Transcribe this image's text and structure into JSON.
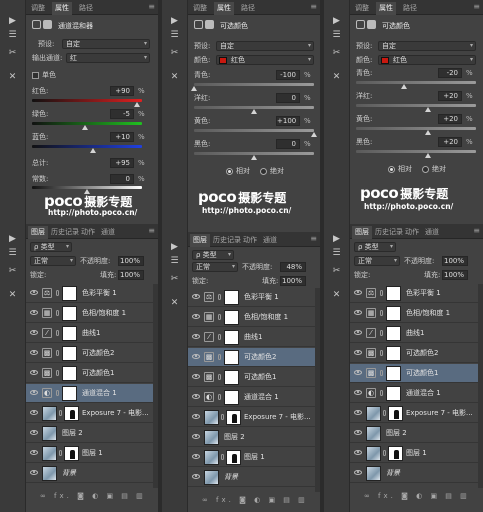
{
  "colors": {
    "panel_bg": "#424242",
    "dark": "#2f2f2f",
    "selected_row": "#596b80",
    "accent_red": "#c8180f"
  },
  "col1": {
    "tabs": [
      "调整",
      "属性",
      "路径"
    ],
    "header_title": "通道混和器",
    "preset_label": "预设:",
    "preset_value": "自定",
    "channel_label": "输出通道:",
    "channel_value": "红",
    "mono_label": "单色",
    "sliders": [
      {
        "label": "红色:",
        "value": "+90",
        "pct": "%",
        "level": 0.95
      },
      {
        "label": "绿色:",
        "value": "-5",
        "pct": "%",
        "level": 0.48
      },
      {
        "label": "蓝色:",
        "value": "+10",
        "pct": "%",
        "level": 0.55
      }
    ],
    "total_label": "总计:",
    "total_value": "+95",
    "total_pct": "%",
    "const_label": "常数:",
    "const_value": "0",
    "const_pct": "%",
    "logo": "poco",
    "logo_cn": "摄影专题",
    "url": "http://photo.poco.cn/",
    "layer_tabs": [
      "图层",
      "历史记录",
      "动作",
      "通道"
    ],
    "kind_label": "ρ 类型",
    "blend_mode": "正常",
    "opacity_label": "不透明度:",
    "opacity_value": "100%",
    "lock_label": "锁定:",
    "fill_label": "填充:",
    "fill_value": "100%",
    "footer_icons": "∞ fx. ◙ ◐ ▣ ▤ ▥",
    "layers": [
      {
        "name": "色彩平衡 1",
        "icon": "⚖",
        "type": "adj"
      },
      {
        "name": "色相/饱和度 1",
        "icon": "▦",
        "type": "adj"
      },
      {
        "name": "曲线1",
        "icon": "⁄",
        "type": "adj"
      },
      {
        "name": "可选颜色2",
        "icon": "▩",
        "type": "adj"
      },
      {
        "name": "可选颜色1",
        "icon": "▩",
        "type": "adj"
      },
      {
        "name": "通道混合 1",
        "icon": "◐",
        "type": "adj",
        "selected": true
      },
      {
        "name": "Exposure 7 - 电影...",
        "type": "img2"
      },
      {
        "name": "图层 2",
        "type": "img"
      },
      {
        "name": "图层 1",
        "type": "img2b"
      },
      {
        "name": "背景",
        "type": "img",
        "italic": true
      }
    ]
  },
  "col2": {
    "tabs": [
      "调整",
      "属性",
      "路径"
    ],
    "header_title": "可选颜色",
    "preset_label": "预设:",
    "preset_value": "自定",
    "color_label": "颜色:",
    "color_value": "红色",
    "sliders": [
      {
        "label": "青色:",
        "value": "-100",
        "pct": "%",
        "level": 0.0
      },
      {
        "label": "洋红:",
        "value": "0",
        "pct": "%",
        "level": 0.5
      },
      {
        "label": "黄色:",
        "value": "+100",
        "pct": "%",
        "level": 1.0
      },
      {
        "label": "黑色:",
        "value": "0",
        "pct": "%",
        "level": 0.5
      }
    ],
    "radio_relative": "相对",
    "radio_absolute": "绝对",
    "logo": "poco",
    "logo_cn": "摄影专题",
    "url": "http://photo.poco.cn/",
    "layer_tabs": [
      "图层",
      "历史记录",
      "动作",
      "通道"
    ],
    "kind_label": "ρ 类型",
    "blend_mode": "正常",
    "opacity_label": "不透明度:",
    "opacity_value": "48%",
    "lock_label": "锁定:",
    "fill_label": "填充:",
    "fill_value": "100%",
    "footer_icons": "∞ fx. ◙ ◐ ▣ ▤ ▥",
    "layers": [
      {
        "name": "色彩平衡 1",
        "icon": "⚖",
        "type": "adj"
      },
      {
        "name": "色相/饱和度 1",
        "icon": "▦",
        "type": "adj"
      },
      {
        "name": "曲线1",
        "icon": "⁄",
        "type": "adj"
      },
      {
        "name": "可选颜色2",
        "icon": "▩",
        "type": "adj",
        "selected": true
      },
      {
        "name": "可选颜色1",
        "icon": "▩",
        "type": "adj"
      },
      {
        "name": "通道混合 1",
        "icon": "◐",
        "type": "adj"
      },
      {
        "name": "Exposure 7 - 电影...",
        "type": "img2"
      },
      {
        "name": "图层 2",
        "type": "img"
      },
      {
        "name": "图层 1",
        "type": "img2b"
      },
      {
        "name": "背景",
        "type": "img",
        "italic": true
      }
    ]
  },
  "col3": {
    "tabs": [
      "调整",
      "属性",
      "路径"
    ],
    "header_title": "可选颜色",
    "preset_label": "预设:",
    "preset_value": "自定",
    "color_label": "颜色:",
    "color_value": "红色",
    "sliders": [
      {
        "label": "青色:",
        "value": "-20",
        "pct": "%",
        "level": 0.4
      },
      {
        "label": "洋红:",
        "value": "+20",
        "pct": "%",
        "level": 0.6
      },
      {
        "label": "黄色:",
        "value": "+20",
        "pct": "%",
        "level": 0.6
      },
      {
        "label": "黑色:",
        "value": "+20",
        "pct": "%",
        "level": 0.6
      }
    ],
    "radio_relative": "相对",
    "radio_absolute": "绝对",
    "logo": "poco",
    "logo_cn": "摄影专题",
    "url": "http://photo.poco.cn/",
    "layer_tabs": [
      "图层",
      "历史记录",
      "动作",
      "通道"
    ],
    "kind_label": "ρ 类型",
    "blend_mode": "正常",
    "opacity_label": "不透明度:",
    "opacity_value": "100%",
    "lock_label": "锁定:",
    "fill_label": "填充:",
    "fill_value": "100%",
    "footer_icons": "∞ fx. ◙ ◐ ▣ ▤ ▥",
    "layers": [
      {
        "name": "色彩平衡 1",
        "icon": "⚖",
        "type": "adj"
      },
      {
        "name": "色相/饱和度 1",
        "icon": "▦",
        "type": "adj"
      },
      {
        "name": "曲线1",
        "icon": "⁄",
        "type": "adj"
      },
      {
        "name": "可选颜色2",
        "icon": "▩",
        "type": "adj"
      },
      {
        "name": "可选颜色1",
        "icon": "▩",
        "type": "adj",
        "selected": true
      },
      {
        "name": "通道混合 1",
        "icon": "◐",
        "type": "adj"
      },
      {
        "name": "Exposure 7 - 电影...",
        "type": "img2"
      },
      {
        "name": "图层 2",
        "type": "img"
      },
      {
        "name": "图层 1",
        "type": "img2b"
      },
      {
        "name": "背景",
        "type": "img",
        "italic": true
      }
    ]
  }
}
